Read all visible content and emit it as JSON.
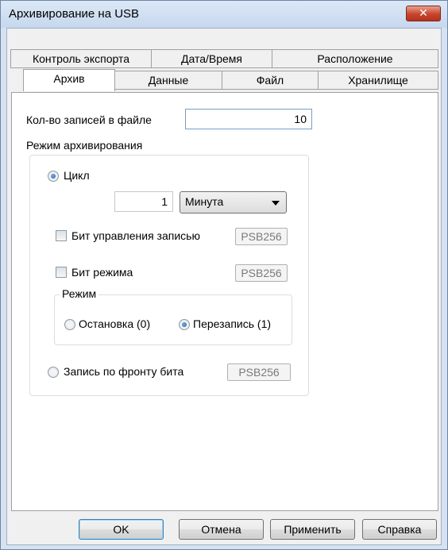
{
  "window": {
    "title": "Архивирование на USB",
    "close_glyph": "✕"
  },
  "tabs": {
    "row_back": [
      "Контроль экспорта",
      "Дата/Время",
      "Расположение"
    ],
    "row_front": [
      "Архив",
      "Данные",
      "Файл",
      "Хранилище"
    ],
    "active": "Архив"
  },
  "archive": {
    "records_label": "Кол-во записей в файле",
    "records_value": "10",
    "mode_group_label": "Режим архивирования",
    "cycle": {
      "label": "Цикл",
      "checked": true,
      "value": "1",
      "unit": "Минута"
    },
    "record_control_bit": {
      "label": "Бит управления записью",
      "checked": false,
      "address": "PSB256"
    },
    "mode_bit": {
      "label": "Бит режима",
      "checked": false,
      "address": "PSB256"
    },
    "mode_subgroup": {
      "label": "Режим",
      "stop_label": "Остановка (0)",
      "stop_checked": false,
      "overwrite_label": "Перезапись (1)",
      "overwrite_checked": true
    },
    "edge_record": {
      "label": "Запись по фронту бита",
      "checked": false,
      "address": "PSB256"
    }
  },
  "buttons": {
    "ok": "OK",
    "cancel": "Отмена",
    "apply": "Применить",
    "help": "Справка"
  }
}
